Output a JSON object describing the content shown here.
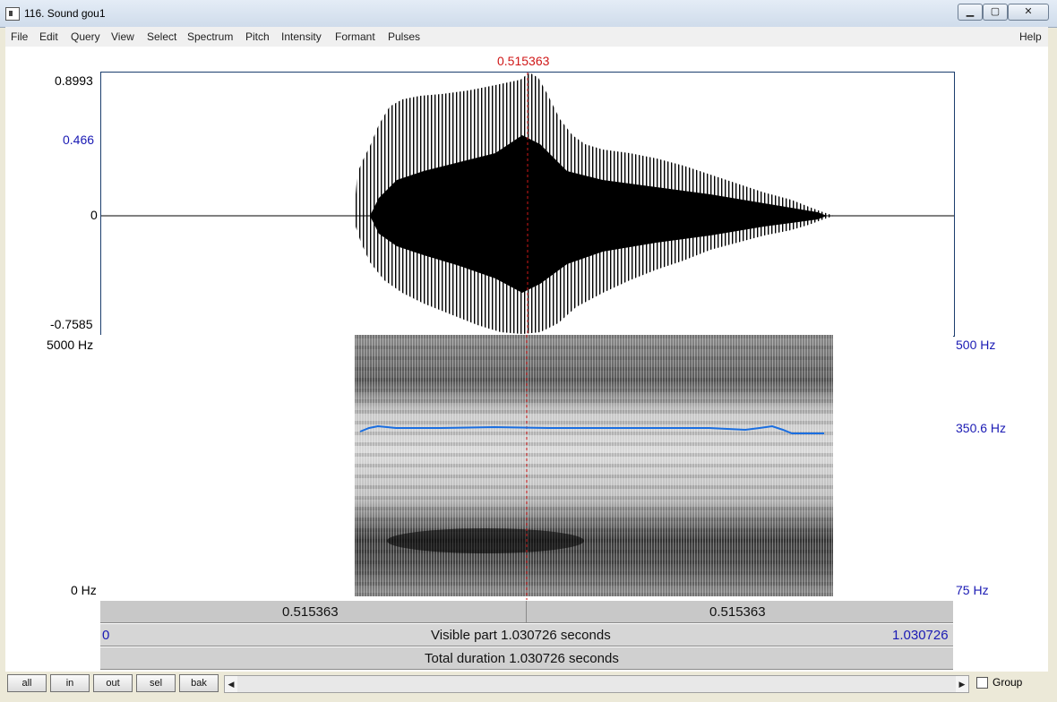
{
  "window": {
    "title": "116. Sound gou1",
    "buttons": {
      "minimize": "▁",
      "maximize": "▢",
      "close": "✕"
    }
  },
  "menu": [
    "File",
    "Edit",
    "Query",
    "View",
    "Select",
    "Spectrum",
    "Pitch",
    "Intensity",
    "Formant",
    "Pulses"
  ],
  "help": "Help",
  "cursor_time": "0.515363",
  "waveform": {
    "ymax": "0.8993",
    "ycursor": "0.466",
    "yzero": "0",
    "ymin": "-0.7585"
  },
  "spectrogram": {
    "fmax": "5000 Hz",
    "fmin": "0 Hz",
    "pitch_max": "500 Hz",
    "pitch_cursor": "350.6 Hz",
    "pitch_min": "75 Hz"
  },
  "time_bar": {
    "left_part": "0.515363",
    "right_part": "0.515363"
  },
  "visible_bar": {
    "start": "0",
    "label": "Visible part 1.030726 seconds",
    "end": "1.030726"
  },
  "total_bar": {
    "label": "Total duration 1.030726 seconds"
  },
  "toolbar": {
    "all": "all",
    "in": "in",
    "out": "out",
    "sel": "sel",
    "bak": "bak",
    "group": "Group",
    "scroll_left": "◀",
    "scroll_right": "▶"
  },
  "colors": {
    "pitch_line": "#1a6ee0",
    "cursor": "#d01818",
    "label_blue": "#1a1ab4",
    "frame": "#1b3d6d"
  }
}
